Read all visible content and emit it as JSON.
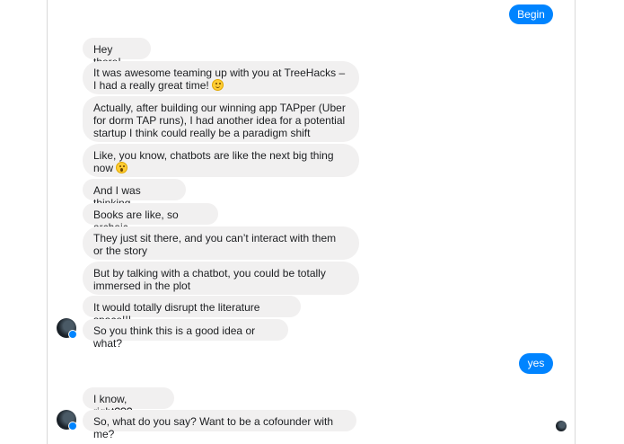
{
  "conversation": {
    "messages": [
      {
        "from": "user",
        "text": "Begin"
      },
      {
        "from": "bot",
        "text": "Hey there!"
      },
      {
        "from": "bot",
        "text": "It was awesome teaming up with you at TreeHacks – I had a really great time!",
        "emoji": "slightly-smiling-face"
      },
      {
        "from": "bot",
        "text": "Actually, after building our winning app TAPper (Uber for dorm TAP runs), I had another idea for a potential startup I think could really be a paradigm shift"
      },
      {
        "from": "bot",
        "text": "Like, you know, chatbots are like the next big thing now",
        "emoji": "face-with-open-mouth"
      },
      {
        "from": "bot",
        "text": "And I was thinking"
      },
      {
        "from": "bot",
        "text": "Books are like, so archaic"
      },
      {
        "from": "bot",
        "text": "They just sit there, and you can’t interact with them or the story"
      },
      {
        "from": "bot",
        "text": "But by talking with a chatbot, you could be totally immersed in the plot"
      },
      {
        "from": "bot",
        "text": "It would totally disrupt the literature space!!!"
      },
      {
        "from": "bot",
        "text": "So you think this is a good idea or what?"
      },
      {
        "from": "user",
        "text": "yes"
      },
      {
        "from": "bot",
        "text": "I know, right???"
      },
      {
        "from": "bot",
        "text": "So, what do you say? Want to be a cofounder with me?"
      }
    ]
  },
  "colors": {
    "outgoing_bubble": "#0084ff",
    "incoming_bubble": "#f1f0f0",
    "incoming_text": "#1c1e21"
  }
}
